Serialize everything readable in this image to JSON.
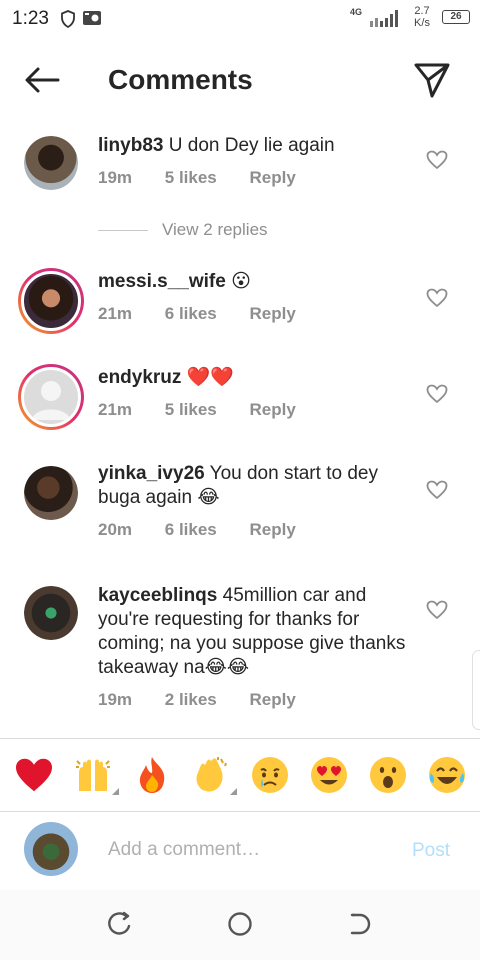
{
  "status_bar": {
    "time": "1:23",
    "network": "4G",
    "speed_value": "2.7",
    "speed_unit": "K/s",
    "battery": "26",
    "icons": [
      "shield-icon",
      "photo-icon",
      "signal-icon",
      "battery-icon"
    ]
  },
  "header": {
    "title": "Comments",
    "back_icon": "arrow-left-icon",
    "send_icon": "paper-plane-icon"
  },
  "comments": [
    {
      "username": "linyb83",
      "text": "U don Dey lie again",
      "time": "19m",
      "likes": "5 likes",
      "reply": "Reply"
    },
    {
      "username": "messi.s__wife",
      "text": "😮",
      "time": "21m",
      "likes": "6 likes",
      "reply": "Reply"
    },
    {
      "username": "endykruz",
      "text": "❤️❤️",
      "time": "21m",
      "likes": "5 likes",
      "reply": "Reply"
    },
    {
      "username": "yinka_ivy26",
      "text": "You don start to dey buga again 😂",
      "time": "20m",
      "likes": "6 likes",
      "reply": "Reply"
    },
    {
      "username": "kayceeblinqs",
      "text": "45million car and you're requesting for thanks for coming; na you suppose give thanks takeaway na😂😂",
      "time": "19m",
      "likes": "2 likes",
      "reply": "Reply"
    }
  ],
  "view_replies": "View 2 replies",
  "emoji_bar": [
    "❤️",
    "🙌",
    "🔥",
    "👏",
    "😢",
    "😍",
    "😮",
    "😂"
  ],
  "add_comment": {
    "placeholder": "Add a comment…",
    "post_label": "Post"
  },
  "colors": {
    "accent": "#0095f6",
    "post_disabled": "#b2dffc",
    "muted": "#8e8e8e",
    "text": "#262626",
    "story_ring_start": "#f5a623",
    "story_ring_end": "#c13584"
  }
}
